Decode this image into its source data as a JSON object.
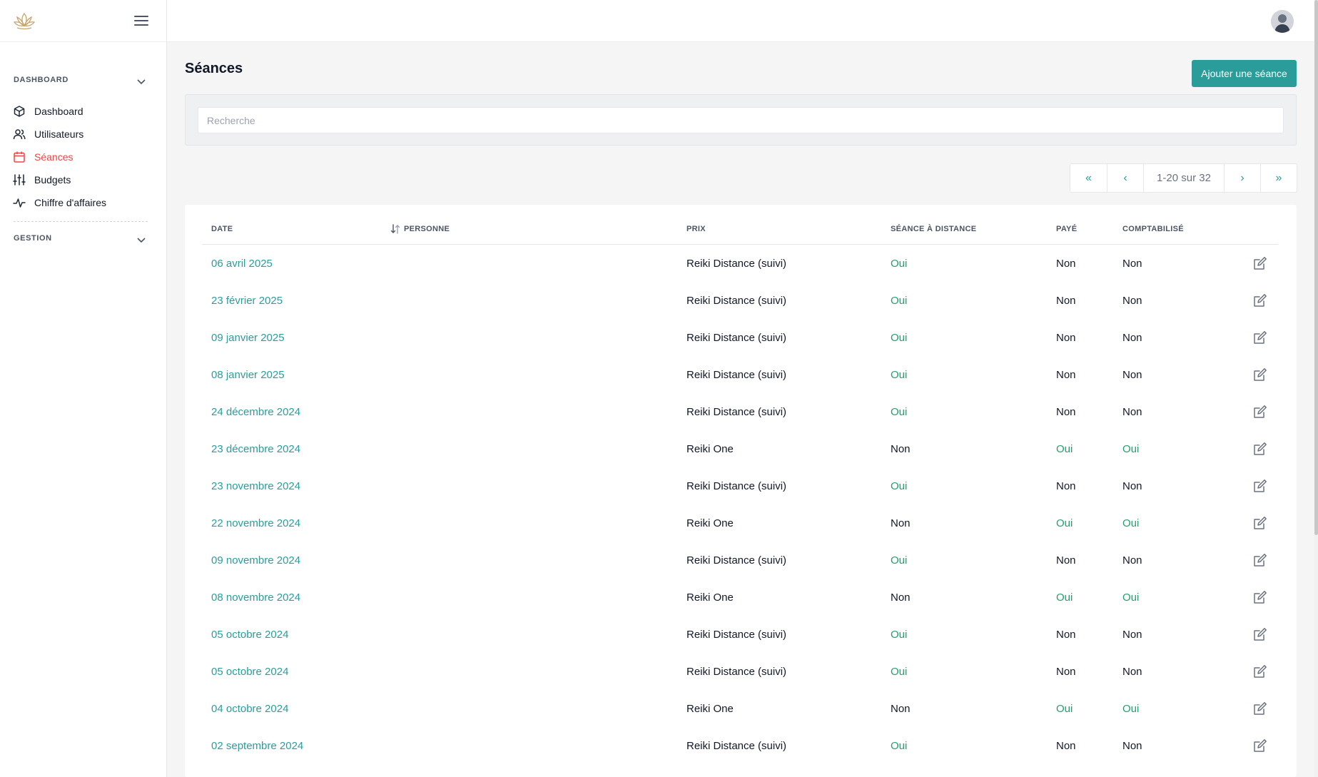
{
  "sidebar": {
    "section_dashboard": "DASHBOARD",
    "section_gestion": "GESTION",
    "items": [
      {
        "label": "Dashboard",
        "icon": "cube-icon"
      },
      {
        "label": "Utilisateurs",
        "icon": "users-icon"
      },
      {
        "label": "Séances",
        "icon": "calendar-icon",
        "active": true
      },
      {
        "label": "Budgets",
        "icon": "sliders-icon"
      },
      {
        "label": "Chiffre d'affaires",
        "icon": "activity-icon"
      }
    ]
  },
  "main": {
    "title": "Séances",
    "add_button": "Ajouter une séance",
    "search_placeholder": "Recherche",
    "pagination": {
      "first": "«",
      "prev": "‹",
      "info": "1-20 sur 32",
      "next": "›",
      "last": "»"
    }
  },
  "table": {
    "columns": {
      "date": "DATE",
      "person": "PERSONNE",
      "price": "PRIX",
      "remote": "SÉANCE À DISTANCE",
      "paid": "PAYÉ",
      "accounted": "COMPTABILISÉ"
    },
    "rows": [
      {
        "date": "06 avril 2025",
        "person": "",
        "price": "Reiki Distance (suivi)",
        "remote": "Oui",
        "paid": "Non",
        "accounted": "Non"
      },
      {
        "date": "23 février 2025",
        "person": "",
        "price": "Reiki Distance (suivi)",
        "remote": "Oui",
        "paid": "Non",
        "accounted": "Non"
      },
      {
        "date": "09 janvier 2025",
        "person": "",
        "price": "Reiki Distance (suivi)",
        "remote": "Oui",
        "paid": "Non",
        "accounted": "Non"
      },
      {
        "date": "08 janvier 2025",
        "person": "",
        "price": "Reiki Distance (suivi)",
        "remote": "Oui",
        "paid": "Non",
        "accounted": "Non"
      },
      {
        "date": "24 décembre 2024",
        "person": "",
        "price": "Reiki Distance (suivi)",
        "remote": "Oui",
        "paid": "Non",
        "accounted": "Non"
      },
      {
        "date": "23 décembre 2024",
        "person": "",
        "price": "Reiki One",
        "remote": "Non",
        "paid": "Oui",
        "accounted": "Oui"
      },
      {
        "date": "23 novembre 2024",
        "person": "",
        "price": "Reiki Distance (suivi)",
        "remote": "Oui",
        "paid": "Non",
        "accounted": "Non"
      },
      {
        "date": "22 novembre 2024",
        "person": "",
        "price": "Reiki One",
        "remote": "Non",
        "paid": "Oui",
        "accounted": "Oui"
      },
      {
        "date": "09 novembre 2024",
        "person": "",
        "price": "Reiki Distance (suivi)",
        "remote": "Oui",
        "paid": "Non",
        "accounted": "Non"
      },
      {
        "date": "08 novembre 2024",
        "person": "",
        "price": "Reiki One",
        "remote": "Non",
        "paid": "Oui",
        "accounted": "Oui"
      },
      {
        "date": "05 octobre 2024",
        "person": "",
        "price": "Reiki Distance (suivi)",
        "remote": "Oui",
        "paid": "Non",
        "accounted": "Non"
      },
      {
        "date": "05 octobre 2024",
        "person": "",
        "price": "Reiki Distance (suivi)",
        "remote": "Oui",
        "paid": "Non",
        "accounted": "Non"
      },
      {
        "date": "04 octobre 2024",
        "person": "",
        "price": "Reiki One",
        "remote": "Non",
        "paid": "Oui",
        "accounted": "Oui"
      },
      {
        "date": "02 septembre 2024",
        "person": "",
        "price": "Reiki Distance (suivi)",
        "remote": "Oui",
        "paid": "Non",
        "accounted": "Non"
      }
    ]
  },
  "colors": {
    "accent": "#2a9d9b",
    "active_nav": "#ef4444",
    "yes": "#22a06b"
  }
}
